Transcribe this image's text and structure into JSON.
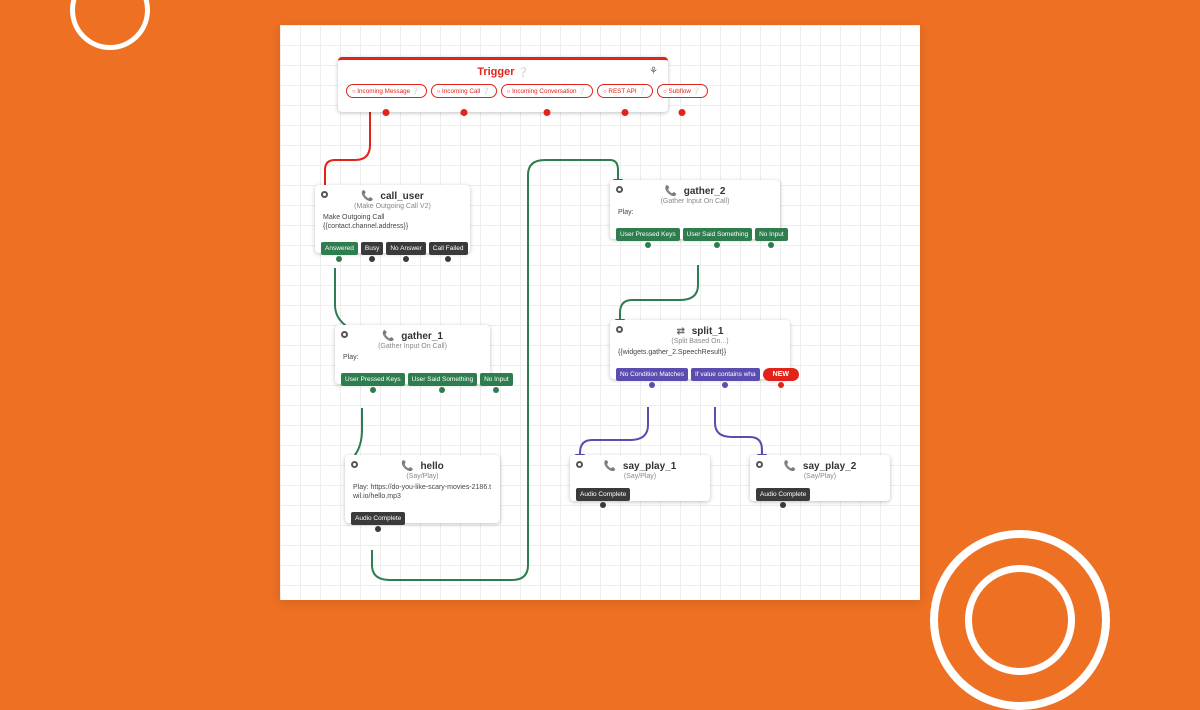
{
  "decor": {
    "accent": "#ee7023"
  },
  "trigger": {
    "title": "Trigger",
    "help_glyph": "❔",
    "share_glyph": "⚘",
    "ports": [
      {
        "label": "Incoming Message ❔"
      },
      {
        "label": "Incoming Call ❔"
      },
      {
        "label": "Incoming Conversation ❔"
      },
      {
        "label": "REST API ❔"
      },
      {
        "label": "Subflow ❔"
      }
    ]
  },
  "widgets": {
    "call_user": {
      "title": "call_user",
      "icon": "📞",
      "subtitle": "(Make Outgoing Call V2)",
      "body": "Make Outgoing Call\n{{contact.channel.address}}",
      "ports": [
        {
          "label": "Answered",
          "cls": "green"
        },
        {
          "label": "Busy",
          "cls": "dark"
        },
        {
          "label": "No Answer",
          "cls": "dark"
        },
        {
          "label": "Call Failed",
          "cls": "dark"
        }
      ]
    },
    "gather_1": {
      "title": "gather_1",
      "icon": "📞",
      "subtitle": "(Gather Input On Call)",
      "body": "Play:",
      "ports": [
        {
          "label": "User Pressed Keys",
          "cls": "green"
        },
        {
          "label": "User Said Something",
          "cls": "green"
        },
        {
          "label": "No Input",
          "cls": "green"
        }
      ]
    },
    "hello": {
      "title": "hello",
      "icon": "📞",
      "subtitle": "(Say/Play)",
      "body": "Play: https://do-you-like-scary-movies-2186.twil.io/hello.mp3",
      "ports": [
        {
          "label": "Audio Complete",
          "cls": "dark"
        }
      ]
    },
    "gather_2": {
      "title": "gather_2",
      "icon": "📞",
      "subtitle": "(Gather Input On Call)",
      "body": "Play:",
      "ports": [
        {
          "label": "User Pressed Keys",
          "cls": "green"
        },
        {
          "label": "User Said Something",
          "cls": "green"
        },
        {
          "label": "No Input",
          "cls": "green"
        }
      ]
    },
    "split_1": {
      "title": "split_1",
      "icon": "⇄",
      "subtitle": "(Split Based On...)",
      "body": "{{widgets.gather_2.SpeechResult}}",
      "ports": [
        {
          "label": "No Condition Matches",
          "cls": "purple"
        },
        {
          "label": "If value contains wha",
          "cls": "purple"
        }
      ],
      "new_label": "NEW"
    },
    "say_play_1": {
      "title": "say_play_1",
      "icon": "📞",
      "subtitle": "(Say/Play)",
      "ports": [
        {
          "label": "Audio Complete",
          "cls": "dark"
        }
      ]
    },
    "say_play_2": {
      "title": "say_play_2",
      "icon": "📞",
      "subtitle": "(Say/Play)",
      "ports": [
        {
          "label": "Audio Complete",
          "cls": "dark"
        }
      ]
    }
  }
}
